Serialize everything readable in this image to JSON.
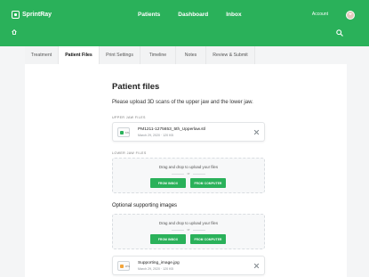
{
  "header": {
    "brand": "SprintRay",
    "nav": [
      "Patients",
      "Dashboard",
      "Inbox"
    ],
    "account_label": "Account"
  },
  "tabs": [
    {
      "label": "Treatment",
      "active": false
    },
    {
      "label": "Patient Files",
      "active": true
    },
    {
      "label": "Print Settings",
      "active": false
    },
    {
      "label": "Timeline",
      "active": false
    },
    {
      "label": "Notes",
      "active": false
    },
    {
      "label": "Review & Submit",
      "active": false
    }
  ],
  "main": {
    "title": "Patient files",
    "subtitle": "Please upload 3D scans of the upper jaw and the lower jaw.",
    "upper": {
      "label": "UPPER JAW FILES",
      "file": {
        "name": "PM1211-1275653_5th_Upperlaw.stl",
        "meta": "March 29, 2020  ·  120 KB",
        "ext": ".STL"
      }
    },
    "lower": {
      "label": "LOWER JAW FILES",
      "drop_text": "Drag and drop to upload your files",
      "or": "or",
      "btn_inbox": "FROM INBOX",
      "btn_computer": "FROM COMPUTER"
    },
    "optional": {
      "label": "Optional supporting images",
      "drop_text": "Drag and drop to upload your files",
      "or": "or",
      "btn_inbox": "FROM INBOX",
      "btn_computer": "FROM COMPUTER",
      "file": {
        "name": "Supporting_image.jpg",
        "meta": "March 29, 2020  ·  120 KB",
        "ext": ".JPG"
      }
    }
  },
  "colors": {
    "brand_green": "#2ab15a",
    "page_bg": "#f4f5f6"
  }
}
